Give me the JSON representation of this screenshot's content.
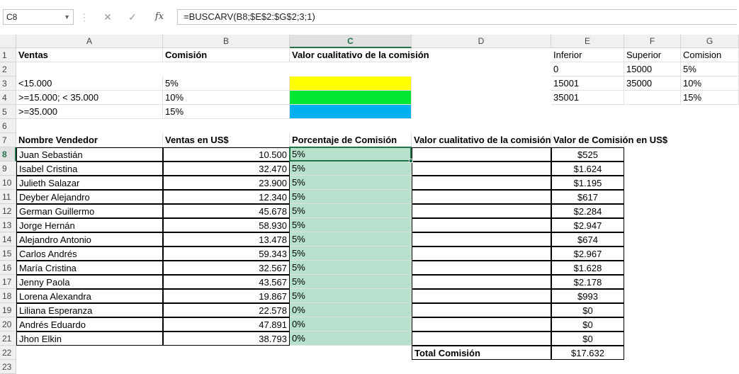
{
  "formula_bar": {
    "name_box": "C8",
    "cancel_glyph": "✕",
    "enter_glyph": "✓",
    "fx_label": "fx",
    "formula": "=BUSCARV(B8;$E$2:$G$2;3;1)"
  },
  "columns": [
    "A",
    "B",
    "C",
    "D",
    "E",
    "F",
    "G"
  ],
  "rows": [
    "1",
    "2",
    "3",
    "4",
    "5",
    "6",
    "7",
    "8",
    "9",
    "10",
    "11",
    "12",
    "13",
    "14",
    "15",
    "16",
    "17",
    "18",
    "19",
    "20",
    "21",
    "22",
    "23"
  ],
  "top_table": {
    "ventas_header": "Ventas",
    "comision_header": "Comisión",
    "cualitativo_header": "Valor cualitativo de la comisión",
    "rows": [
      {
        "ventas": "<15.000",
        "comision": "5%",
        "color": "#ffff00"
      },
      {
        "ventas": ">=15.000; < 35.000",
        "comision": "10%",
        "color": "#00e632"
      },
      {
        "ventas": ">=35.000",
        "comision": "15%",
        "color": "#00b0f0"
      }
    ]
  },
  "lookup_table": {
    "inferior_header": "Inferior",
    "superior_header": "Superior",
    "comision_header": "Comision",
    "rows": [
      {
        "inferior": "0",
        "superior": "15000",
        "comision": "5%"
      },
      {
        "inferior": "15001",
        "superior": "35000",
        "comision": "10%"
      },
      {
        "inferior": "35001",
        "superior": "",
        "comision": "15%"
      }
    ]
  },
  "main_table": {
    "headers": {
      "nombre": "Nombre Vendedor",
      "ventas": "Ventas en US$",
      "porcentaje": "Porcentaje de Comisión",
      "cualitativo": "Valor cualitativo de la comisión",
      "valor": "Valor de Comisión en US$"
    },
    "rows": [
      {
        "nombre": "Juan Sebastián",
        "ventas": "10.500",
        "porcentaje": "5%",
        "valor": "$525"
      },
      {
        "nombre": "Isabel Cristina",
        "ventas": "32.470",
        "porcentaje": "5%",
        "valor": "$1.624"
      },
      {
        "nombre": "Julieth Salazar",
        "ventas": "23.900",
        "porcentaje": "5%",
        "valor": "$1.195"
      },
      {
        "nombre": "Deyber Alejandro",
        "ventas": "12.340",
        "porcentaje": "5%",
        "valor": "$617"
      },
      {
        "nombre": "German Guillermo",
        "ventas": "45.678",
        "porcentaje": "5%",
        "valor": "$2.284"
      },
      {
        "nombre": "Jorge Hernán",
        "ventas": "58.930",
        "porcentaje": "5%",
        "valor": "$2.947"
      },
      {
        "nombre": "Alejandro Antonio",
        "ventas": "13.478",
        "porcentaje": "5%",
        "valor": "$674"
      },
      {
        "nombre": "Carlos Andrés",
        "ventas": "59.343",
        "porcentaje": "5%",
        "valor": "$2.967"
      },
      {
        "nombre": "María Cristina",
        "ventas": "32.567",
        "porcentaje": "5%",
        "valor": "$1.628"
      },
      {
        "nombre": "Jenny Paola",
        "ventas": "43.567",
        "porcentaje": "5%",
        "valor": "$2.178"
      },
      {
        "nombre": "Lorena Alexandra",
        "ventas": "19.867",
        "porcentaje": "5%",
        "valor": "$993"
      },
      {
        "nombre": "Liliana Esperanza",
        "ventas": "22.578",
        "porcentaje": "0%",
        "valor": "$0"
      },
      {
        "nombre": "Andrés Eduardo",
        "ventas": "47.891",
        "porcentaje": "0%",
        "valor": "$0"
      },
      {
        "nombre": "Jhon Elkin",
        "ventas": "38.793",
        "porcentaje": "0%",
        "valor": "$0"
      }
    ],
    "total_label": "Total Comisión",
    "total_value": "$17.632"
  },
  "selected_cell": "C8",
  "colors": {
    "selection_fill": "#b7e1cd",
    "selection_border": "#217346",
    "header_bg": "#f0f0f0"
  }
}
